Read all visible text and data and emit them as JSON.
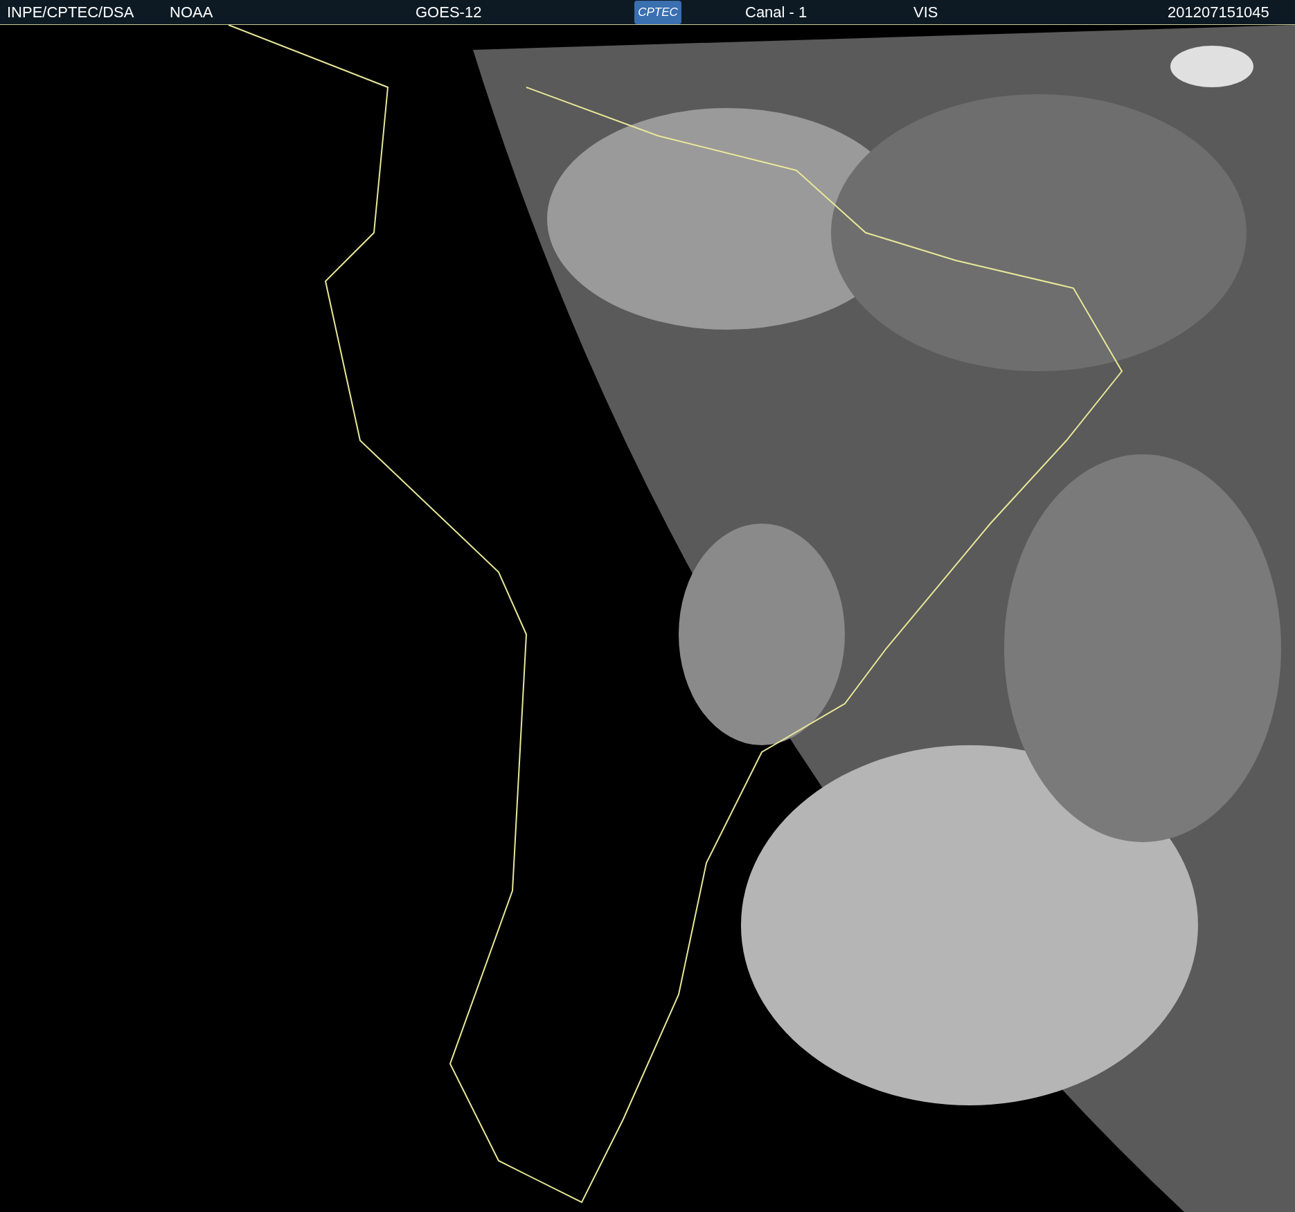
{
  "header": {
    "source": "INPE/CPTEC/DSA",
    "agency": "NOAA",
    "satellite": "GOES-12",
    "logo": "CPTEC",
    "channel": "Canal - 1",
    "band": "VIS",
    "timestamp": "201207151045"
  }
}
